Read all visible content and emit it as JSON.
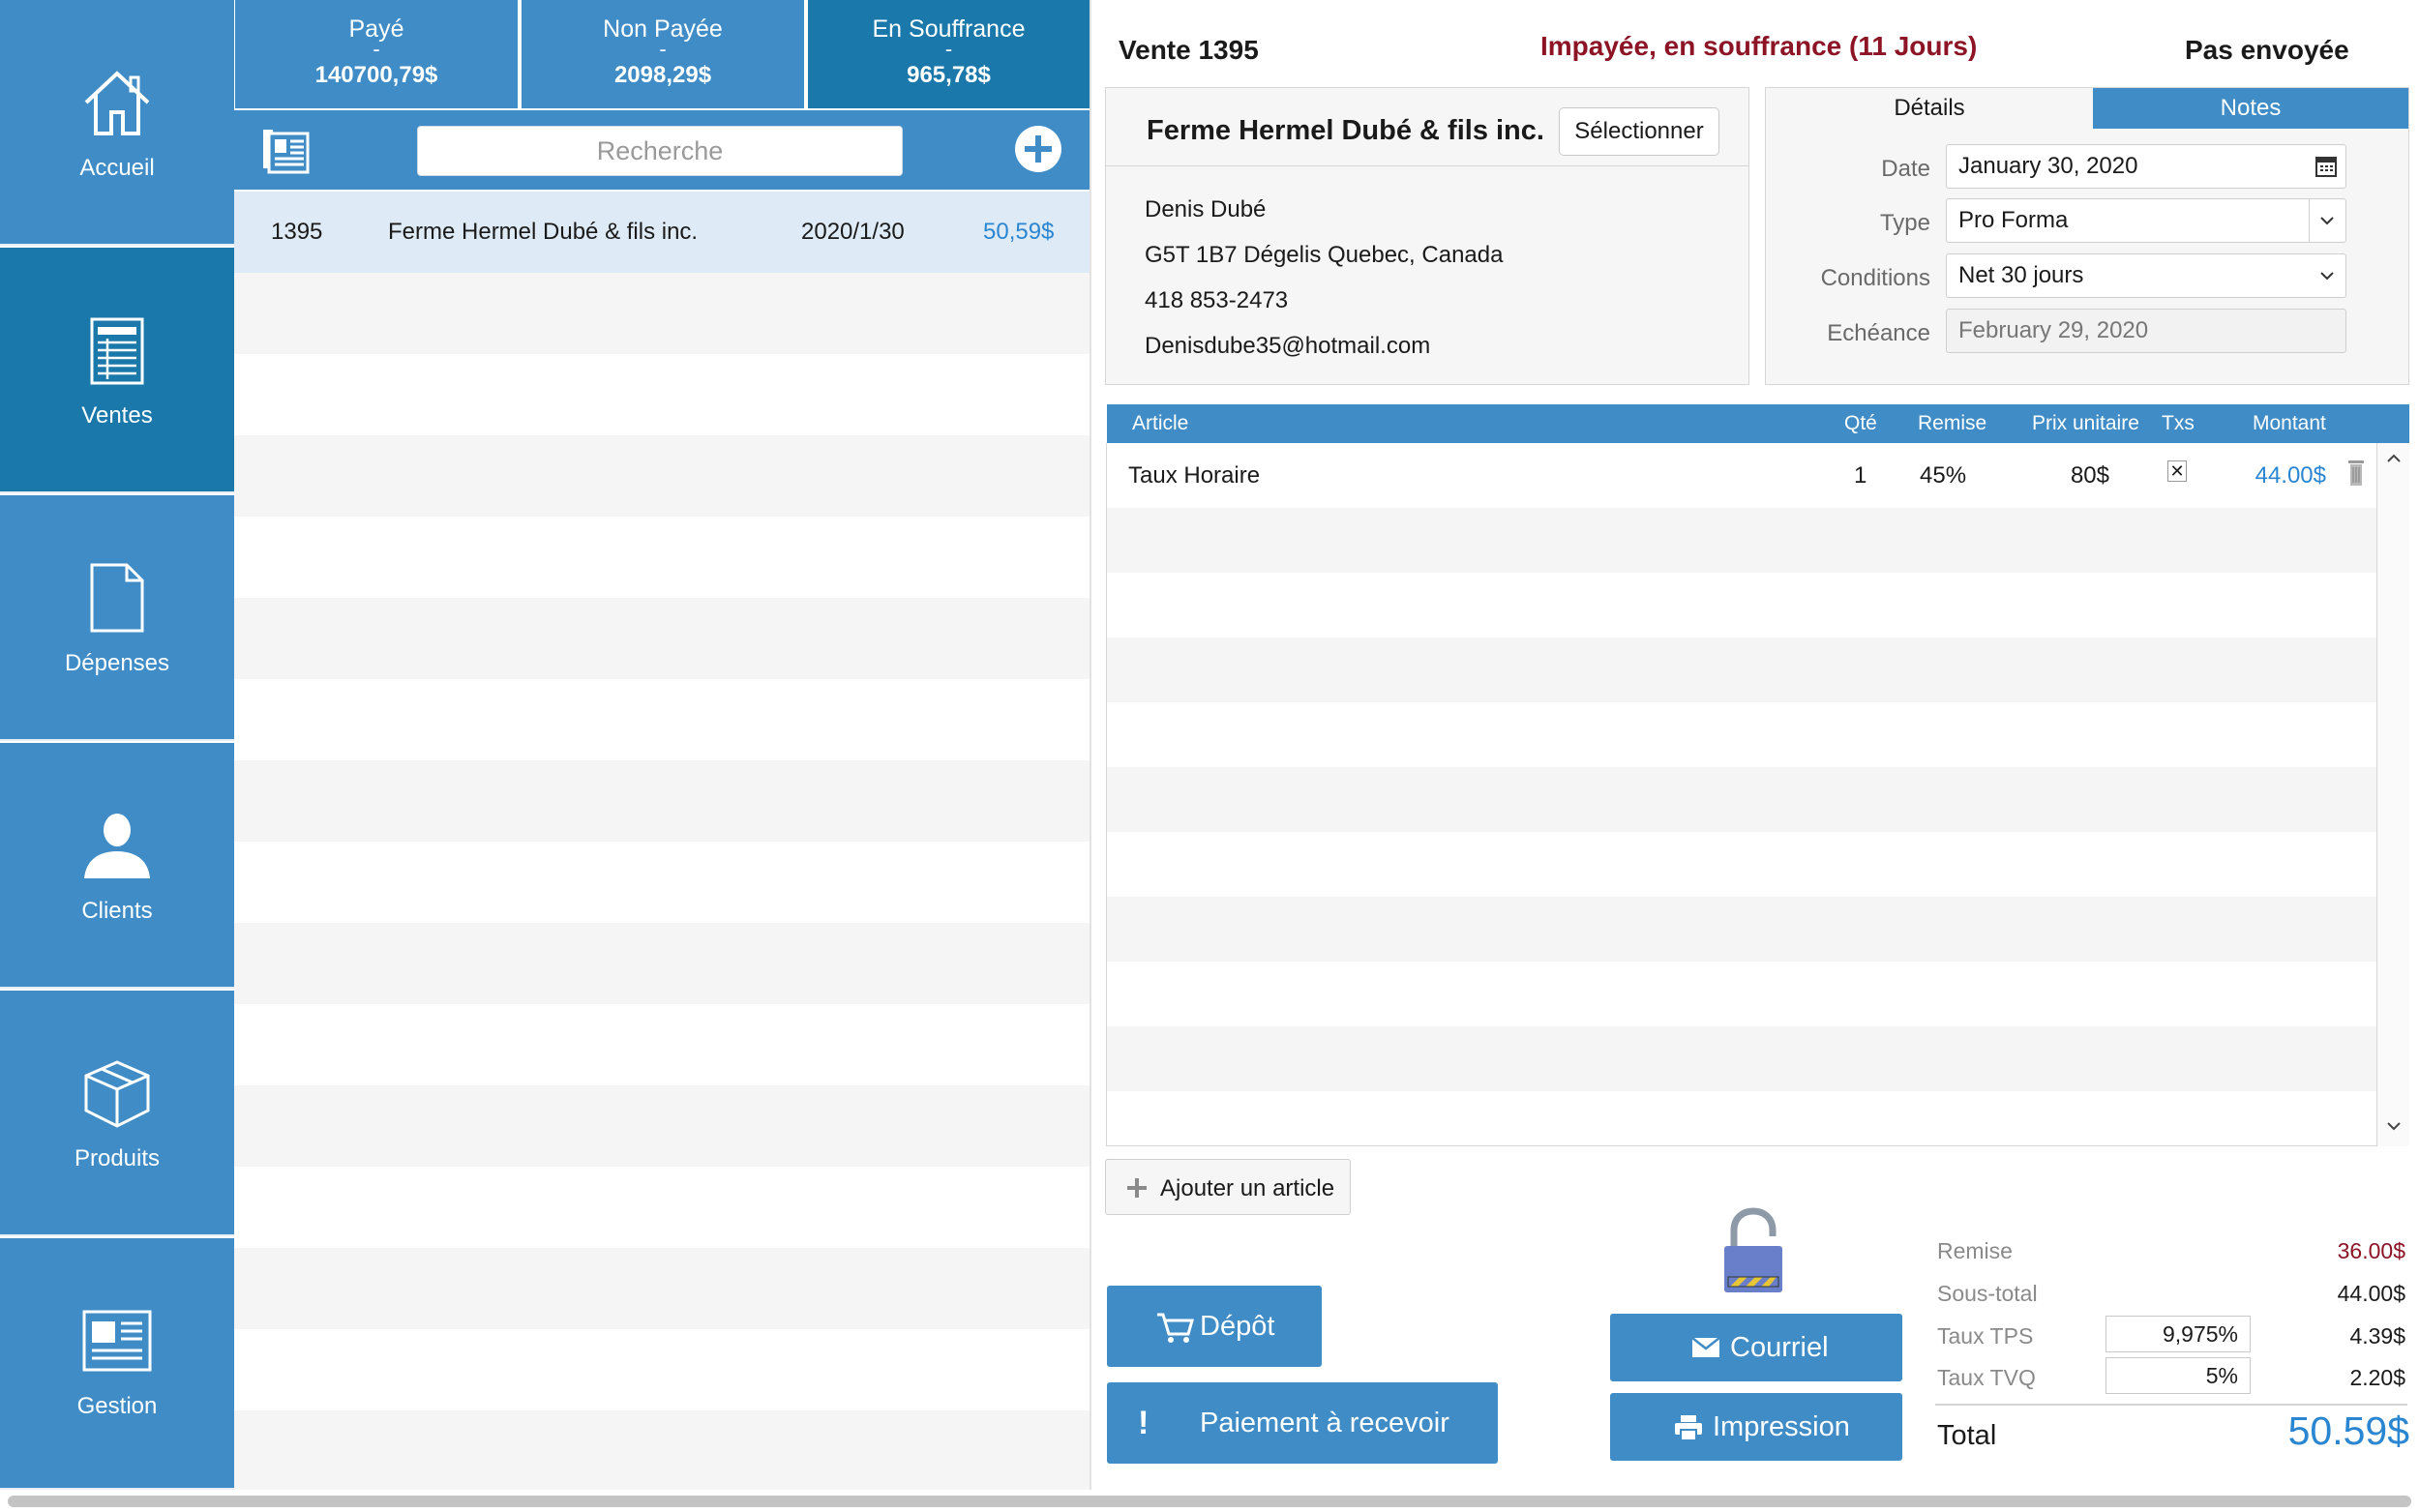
{
  "sidebar": {
    "items": [
      {
        "label": "Accueil",
        "icon": "home-icon"
      },
      {
        "label": "Ventes",
        "icon": "sales-ledger-icon"
      },
      {
        "label": "Dépenses",
        "icon": "document-icon"
      },
      {
        "label": "Clients",
        "icon": "person-icon"
      },
      {
        "label": "Produits",
        "icon": "box-icon"
      },
      {
        "label": "Gestion",
        "icon": "newspaper-icon"
      }
    ]
  },
  "summary": {
    "paid": {
      "label": "Payé",
      "sep": "-",
      "amount": "140700,79$"
    },
    "unpaid": {
      "label": "Non Payée",
      "sep": "-",
      "amount": "2098,29$"
    },
    "overdue": {
      "label": "En Souffrance",
      "sep": "-",
      "amount": "965,78$"
    }
  },
  "list": {
    "search_placeholder": "Recherche",
    "rows": [
      {
        "number": "1395",
        "client": "Ferme Hermel Dubé & fils inc.",
        "date": "2020/1/30",
        "amount": "50,59$"
      }
    ]
  },
  "invoice": {
    "title": "Vente 1395",
    "status": "Impayée, en souffrance (11 Jours)",
    "sent_status": "Pas envoyée"
  },
  "customer": {
    "name": "Ferme Hermel Dubé & fils inc.",
    "select_label": "Sélectionner",
    "contact": "Denis Dubé",
    "address": "G5T 1B7 Dégelis Quebec, Canada",
    "phone": "418 853-2473",
    "email": "Denisdube35@hotmail.com"
  },
  "details": {
    "tab_details": "Détails",
    "tab_notes": "Notes",
    "date_label": "Date",
    "date_value": "January 30, 2020",
    "type_label": "Type",
    "type_value": "Pro Forma",
    "terms_label": "Conditions",
    "terms_value": "Net 30 jours",
    "due_label": "Echéance",
    "due_value": "February 29, 2020"
  },
  "table": {
    "headers": {
      "article": "Article",
      "qty": "Qté",
      "discount": "Remise",
      "unit_price": "Prix unitaire",
      "taxes": "Txs",
      "amount": "Montant"
    },
    "rows": [
      {
        "article": "Taux Horaire",
        "qty": "1",
        "discount": "45%",
        "unit_price": "80$",
        "taxed": "✕",
        "amount": "44.00$"
      }
    ]
  },
  "actions": {
    "add_item": "Ajouter un article",
    "deposit": "Dépôt",
    "receive_payment": "Paiement à recevoir",
    "email": "Courriel",
    "print": "Impression"
  },
  "totals": {
    "discount_label": "Remise",
    "discount_value": "36.00$",
    "subtotal_label": "Sous-total",
    "subtotal_value": "44.00$",
    "tps_label": "Taux TPS",
    "tps_rate": "9,975%",
    "tps_value": "4.39$",
    "tvq_label": "Taux TVQ",
    "tvq_rate": "5%",
    "tvq_value": "2.20$",
    "total_label": "Total",
    "total_value": "50.59$"
  },
  "colors": {
    "primary": "#3f8cc6",
    "primary_dark": "#1a78ab",
    "status_red": "#8c1425",
    "amount_blue": "#2a86d1",
    "selected_row": "#deebf6"
  }
}
